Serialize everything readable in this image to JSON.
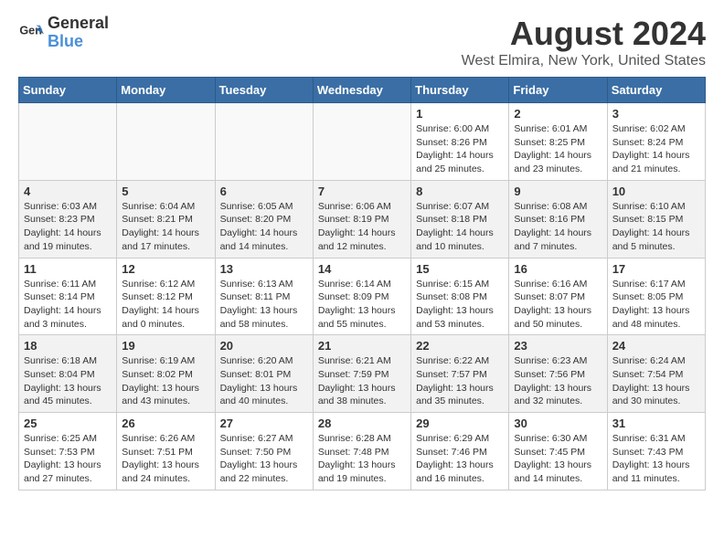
{
  "logo": {
    "line1": "General",
    "line2": "Blue"
  },
  "title": "August 2024",
  "location": "West Elmira, New York, United States",
  "days_of_week": [
    "Sunday",
    "Monday",
    "Tuesday",
    "Wednesday",
    "Thursday",
    "Friday",
    "Saturday"
  ],
  "weeks": [
    [
      {
        "day": "",
        "info": ""
      },
      {
        "day": "",
        "info": ""
      },
      {
        "day": "",
        "info": ""
      },
      {
        "day": "",
        "info": ""
      },
      {
        "day": "1",
        "info": "Sunrise: 6:00 AM\nSunset: 8:26 PM\nDaylight: 14 hours and 25 minutes."
      },
      {
        "day": "2",
        "info": "Sunrise: 6:01 AM\nSunset: 8:25 PM\nDaylight: 14 hours and 23 minutes."
      },
      {
        "day": "3",
        "info": "Sunrise: 6:02 AM\nSunset: 8:24 PM\nDaylight: 14 hours and 21 minutes."
      }
    ],
    [
      {
        "day": "4",
        "info": "Sunrise: 6:03 AM\nSunset: 8:23 PM\nDaylight: 14 hours and 19 minutes."
      },
      {
        "day": "5",
        "info": "Sunrise: 6:04 AM\nSunset: 8:21 PM\nDaylight: 14 hours and 17 minutes."
      },
      {
        "day": "6",
        "info": "Sunrise: 6:05 AM\nSunset: 8:20 PM\nDaylight: 14 hours and 14 minutes."
      },
      {
        "day": "7",
        "info": "Sunrise: 6:06 AM\nSunset: 8:19 PM\nDaylight: 14 hours and 12 minutes."
      },
      {
        "day": "8",
        "info": "Sunrise: 6:07 AM\nSunset: 8:18 PM\nDaylight: 14 hours and 10 minutes."
      },
      {
        "day": "9",
        "info": "Sunrise: 6:08 AM\nSunset: 8:16 PM\nDaylight: 14 hours and 7 minutes."
      },
      {
        "day": "10",
        "info": "Sunrise: 6:10 AM\nSunset: 8:15 PM\nDaylight: 14 hours and 5 minutes."
      }
    ],
    [
      {
        "day": "11",
        "info": "Sunrise: 6:11 AM\nSunset: 8:14 PM\nDaylight: 14 hours and 3 minutes."
      },
      {
        "day": "12",
        "info": "Sunrise: 6:12 AM\nSunset: 8:12 PM\nDaylight: 14 hours and 0 minutes."
      },
      {
        "day": "13",
        "info": "Sunrise: 6:13 AM\nSunset: 8:11 PM\nDaylight: 13 hours and 58 minutes."
      },
      {
        "day": "14",
        "info": "Sunrise: 6:14 AM\nSunset: 8:09 PM\nDaylight: 13 hours and 55 minutes."
      },
      {
        "day": "15",
        "info": "Sunrise: 6:15 AM\nSunset: 8:08 PM\nDaylight: 13 hours and 53 minutes."
      },
      {
        "day": "16",
        "info": "Sunrise: 6:16 AM\nSunset: 8:07 PM\nDaylight: 13 hours and 50 minutes."
      },
      {
        "day": "17",
        "info": "Sunrise: 6:17 AM\nSunset: 8:05 PM\nDaylight: 13 hours and 48 minutes."
      }
    ],
    [
      {
        "day": "18",
        "info": "Sunrise: 6:18 AM\nSunset: 8:04 PM\nDaylight: 13 hours and 45 minutes."
      },
      {
        "day": "19",
        "info": "Sunrise: 6:19 AM\nSunset: 8:02 PM\nDaylight: 13 hours and 43 minutes."
      },
      {
        "day": "20",
        "info": "Sunrise: 6:20 AM\nSunset: 8:01 PM\nDaylight: 13 hours and 40 minutes."
      },
      {
        "day": "21",
        "info": "Sunrise: 6:21 AM\nSunset: 7:59 PM\nDaylight: 13 hours and 38 minutes."
      },
      {
        "day": "22",
        "info": "Sunrise: 6:22 AM\nSunset: 7:57 PM\nDaylight: 13 hours and 35 minutes."
      },
      {
        "day": "23",
        "info": "Sunrise: 6:23 AM\nSunset: 7:56 PM\nDaylight: 13 hours and 32 minutes."
      },
      {
        "day": "24",
        "info": "Sunrise: 6:24 AM\nSunset: 7:54 PM\nDaylight: 13 hours and 30 minutes."
      }
    ],
    [
      {
        "day": "25",
        "info": "Sunrise: 6:25 AM\nSunset: 7:53 PM\nDaylight: 13 hours and 27 minutes."
      },
      {
        "day": "26",
        "info": "Sunrise: 6:26 AM\nSunset: 7:51 PM\nDaylight: 13 hours and 24 minutes."
      },
      {
        "day": "27",
        "info": "Sunrise: 6:27 AM\nSunset: 7:50 PM\nDaylight: 13 hours and 22 minutes."
      },
      {
        "day": "28",
        "info": "Sunrise: 6:28 AM\nSunset: 7:48 PM\nDaylight: 13 hours and 19 minutes."
      },
      {
        "day": "29",
        "info": "Sunrise: 6:29 AM\nSunset: 7:46 PM\nDaylight: 13 hours and 16 minutes."
      },
      {
        "day": "30",
        "info": "Sunrise: 6:30 AM\nSunset: 7:45 PM\nDaylight: 13 hours and 14 minutes."
      },
      {
        "day": "31",
        "info": "Sunrise: 6:31 AM\nSunset: 7:43 PM\nDaylight: 13 hours and 11 minutes."
      }
    ]
  ]
}
